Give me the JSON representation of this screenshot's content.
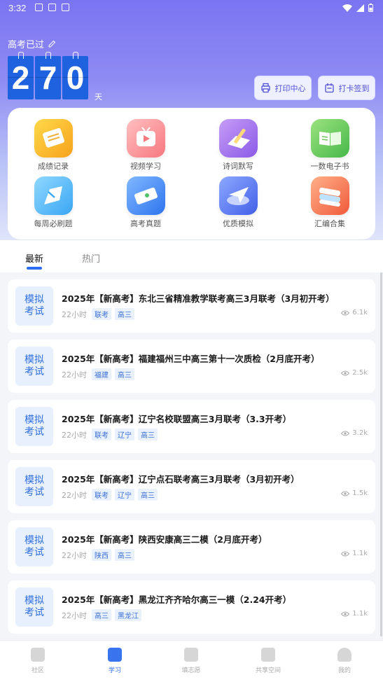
{
  "status_bar": {
    "time": "3:32"
  },
  "header": {
    "since_label": "高考已过",
    "day_digits": [
      "2",
      "7",
      "0"
    ],
    "day_unit": "天",
    "print_center_label": "打印中心",
    "checkin_label": "打卡签到"
  },
  "grid": {
    "items": [
      {
        "label": "成绩记录",
        "icon": "grade-record-icon"
      },
      {
        "label": "视频学习",
        "icon": "video-learning-icon"
      },
      {
        "label": "诗词默写",
        "icon": "poetry-dictation-icon"
      },
      {
        "label": "一数电子书",
        "icon": "ebook-icon"
      },
      {
        "label": "每周必刷题",
        "icon": "weekly-exercises-icon"
      },
      {
        "label": "高考真题",
        "icon": "past-exams-icon"
      },
      {
        "label": "优质模拟",
        "icon": "quality-mock-icon"
      },
      {
        "label": "汇编合集",
        "icon": "compilation-icon"
      }
    ]
  },
  "tabs": {
    "latest": "最新",
    "hot": "热门"
  },
  "list": {
    "items": [
      {
        "badge_line1": "模拟",
        "badge_line2": "考试",
        "title": "2025年【新高考】东北三省精准教学联考高三3月联考（3月初开考）",
        "time": "22小时",
        "tags": [
          "联考",
          "高三"
        ],
        "views": "6.1k"
      },
      {
        "badge_line1": "模拟",
        "badge_line2": "考试",
        "title": "2025年【新高考】福建福州三中高三第十一次质检（2月底开考）",
        "time": "22小时",
        "tags": [
          "福建",
          "高三"
        ],
        "views": "2.5k"
      },
      {
        "badge_line1": "模拟",
        "badge_line2": "考试",
        "title": "2025年【新高考】辽宁名校联盟高三3月联考（3.3开考）",
        "time": "22小时",
        "tags": [
          "联考",
          "辽宁",
          "高三"
        ],
        "views": "3.2k"
      },
      {
        "badge_line1": "模拟",
        "badge_line2": "考试",
        "title": "2025年【新高考】辽宁点石联考高三3月联考（3月初开考）",
        "time": "22小时",
        "tags": [
          "联考",
          "辽宁",
          "高三"
        ],
        "views": "1.5k"
      },
      {
        "badge_line1": "模拟",
        "badge_line2": "考试",
        "title": "2025年【新高考】陕西安康高三二模（2月底开考）",
        "time": "22小时",
        "tags": [
          "陕西",
          "高三"
        ],
        "views": "1.1k"
      },
      {
        "badge_line1": "模拟",
        "badge_line2": "考试",
        "title": "2025年【新高考】黑龙江齐齐哈尔高三一模（2.24开考）",
        "time": "22小时",
        "tags": [
          "高三",
          "黑龙江"
        ],
        "views": "1.1k"
      }
    ]
  },
  "bottom_nav": {
    "community": "社区",
    "study": "学习",
    "application": "填志愿",
    "shared_space": "共享空间",
    "mine": "我的"
  }
}
